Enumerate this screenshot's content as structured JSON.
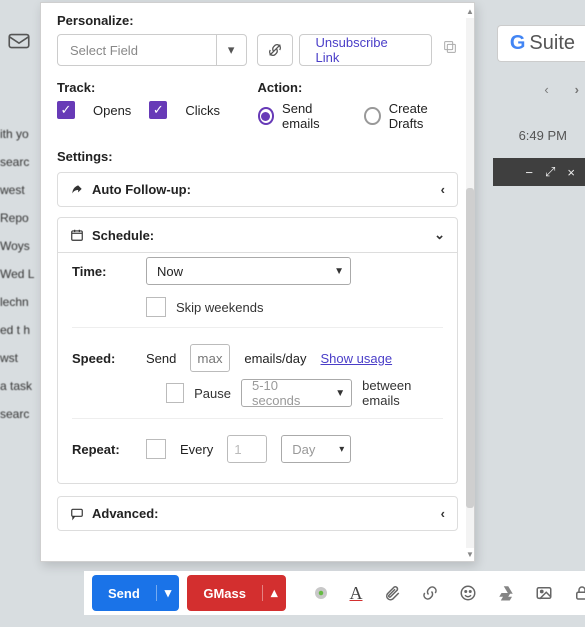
{
  "top_right": {
    "suite_prefix": "G",
    "suite_text": "Suite",
    "time": "6:49 PM"
  },
  "panel": {
    "personalize_label": "Personalize:",
    "select_field_placeholder": "Select Field",
    "unsubscribe_label": "Unsubscribe Link",
    "track_label": "Track:",
    "opens_label": "Opens",
    "clicks_label": "Clicks",
    "action_label": "Action:",
    "send_emails_label": "Send emails",
    "create_drafts_label": "Create Drafts",
    "settings_label": "Settings:",
    "auto_followup_label": "Auto Follow-up:",
    "schedule_label": "Schedule:",
    "advanced_label": "Advanced:",
    "schedule": {
      "time_label": "Time:",
      "time_value": "Now",
      "skip_weekends_label": "Skip weekends",
      "speed_label": "Speed:",
      "speed_prefix": "Send",
      "speed_input": "max",
      "speed_suffix": "emails/day",
      "show_usage": "Show usage",
      "pause_label": "Pause",
      "pause_value": "5-10 seconds",
      "pause_suffix": "between emails",
      "repeat_label": "Repeat:",
      "repeat_every": "Every",
      "repeat_count": "1",
      "repeat_unit": "Day"
    }
  },
  "compose": {
    "send": "Send",
    "gmass": "GMass"
  }
}
